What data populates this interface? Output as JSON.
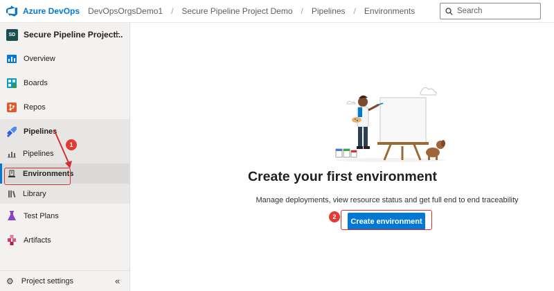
{
  "header": {
    "brand": "Azure DevOps",
    "breadcrumbs": [
      "DevOpsOrgsDemo1",
      "Secure Pipeline Project Demo",
      "Pipelines",
      "Environments"
    ],
    "search_placeholder": "Search"
  },
  "sidebar": {
    "project_initials": "SD",
    "project_name": "Secure Pipeline Project...",
    "items": [
      {
        "label": "Overview"
      },
      {
        "label": "Boards"
      },
      {
        "label": "Repos"
      },
      {
        "label": "Pipelines"
      },
      {
        "label": "Pipelines"
      },
      {
        "label": "Environments"
      },
      {
        "label": "Library"
      },
      {
        "label": "Test Plans"
      },
      {
        "label": "Artifacts"
      }
    ],
    "footer_label": "Project settings"
  },
  "main": {
    "title": "Create your first environment",
    "subtitle": "Manage deployments, view resource status and get full end to end traceability",
    "button_label": "Create environment"
  },
  "annotations": [
    "1",
    "2"
  ],
  "colors": {
    "accent": "#0078d4",
    "annotation": "#d32f2f"
  }
}
